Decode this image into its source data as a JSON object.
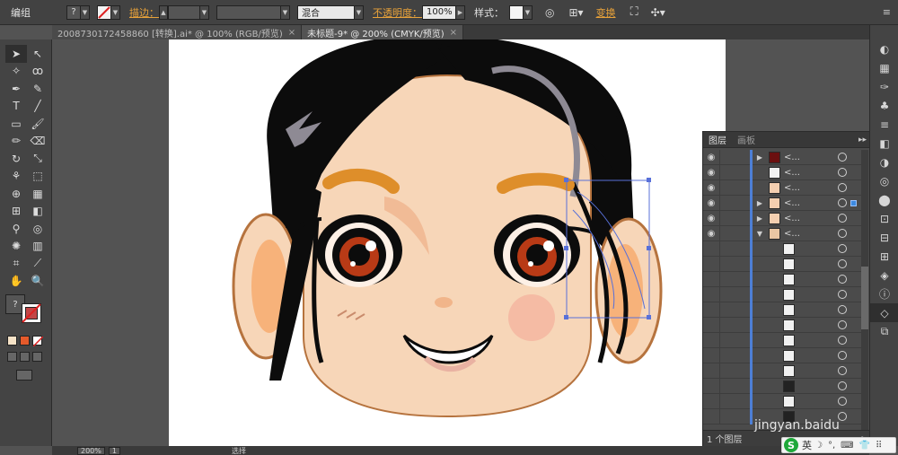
{
  "control_bar": {
    "group_label": "编组",
    "stroke_link": "描边：",
    "blend_mode": "混合",
    "opacity_link": "不透明度：",
    "opacity_value": "100%",
    "style_label": "样式：",
    "transform_link": "变换"
  },
  "tabs": [
    {
      "label": "20087301724588​60 [转换].ai* @ 100% (RGB/预览)",
      "close": "×",
      "active": false
    },
    {
      "label": "未标题-9* @ 200% (CMYK/预览)",
      "close": "×",
      "active": true
    }
  ],
  "layers_panel": {
    "tab_layers": "图层",
    "tab_artboards": "画板",
    "menu_icon": "▸▸",
    "row_name": "<...",
    "footer_text": "1 个图层"
  },
  "status_bar": {
    "zoom": "200%",
    "artboard_num": "1",
    "tool_label": "选择"
  },
  "ime": {
    "logo": "S",
    "lang": "英",
    "icons": [
      "moon-icon",
      "comma-icon",
      "keyboard-icon",
      "skin-icon",
      "grid-icon"
    ]
  },
  "watermark": "jingyan.baidu"
}
